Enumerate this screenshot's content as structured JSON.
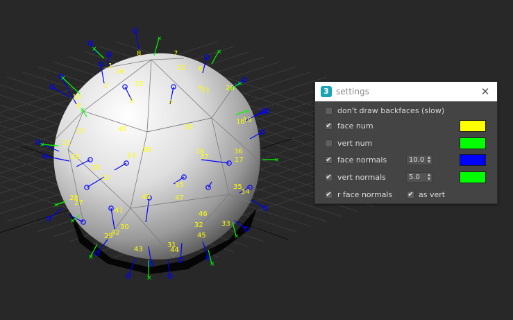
{
  "settings": {
    "title": "settings",
    "app_icon": "3",
    "close_glyph": "✕",
    "check_glyph": "✔",
    "rows": {
      "dont_draw_backfaces": {
        "label": "don't draw backfaces (slow)",
        "checked": false
      },
      "face_num": {
        "label": "face num",
        "checked": true,
        "color": "#ffff00"
      },
      "vert_num": {
        "label": "vert num",
        "checked": false,
        "color": "#00ff00"
      },
      "face_normals": {
        "label": "face normals",
        "checked": true,
        "value": "10.0",
        "color": "#0000ff"
      },
      "vert_normals": {
        "label": "vert normals",
        "checked": true,
        "value": "5.0",
        "color": "#00ff00"
      },
      "r_face_normals": {
        "label": "r face normals",
        "checked": true
      },
      "as_vert": {
        "label": "as vert",
        "checked": true
      }
    }
  },
  "viewport": {
    "face_numbers": [
      "1",
      "2",
      "3",
      "4",
      "5",
      "6",
      "7",
      "8",
      "9",
      "10",
      "11",
      "12",
      "13",
      "14",
      "15",
      "16",
      "17",
      "18",
      "19",
      "20",
      "21",
      "22",
      "23",
      "24",
      "25",
      "26",
      "27",
      "28",
      "29",
      "30",
      "31",
      "32",
      "33",
      "34",
      "35",
      "36",
      "37",
      "38",
      "39",
      "40",
      "41",
      "42",
      "43",
      "44",
      "45",
      "46",
      "47",
      "48"
    ]
  }
}
